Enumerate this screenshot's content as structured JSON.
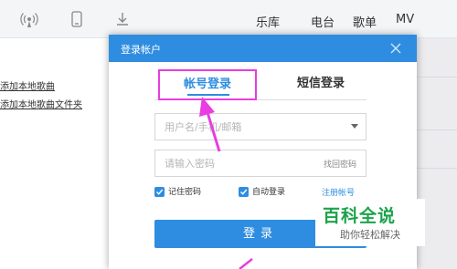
{
  "topbar": {
    "icons": [
      "broadcast-icon",
      "mobile-phone-icon",
      "download-icon"
    ],
    "nav": [
      "乐库",
      "电台",
      "歌单",
      "MV"
    ]
  },
  "background": {
    "links": [
      "添加本地歌曲",
      "添加本地歌曲文件夹"
    ]
  },
  "dialog": {
    "title": "登录帐户",
    "tabs": {
      "account": "帐号登录",
      "sms": "短信登录"
    },
    "username_placeholder": "用户名/手机/邮箱",
    "password_placeholder": "请输入密码",
    "forgot_password": "找回密码",
    "remember_password": "记住密码",
    "auto_login": "自动登录",
    "register": "注册帐号",
    "login_button": "登录"
  },
  "watermark": {
    "logo": "百科全说",
    "subtitle": "助你轻松解决"
  },
  "colors": {
    "accent": "#2e8de0",
    "highlight": "#e83de0",
    "watermark": "#1aa34a"
  }
}
